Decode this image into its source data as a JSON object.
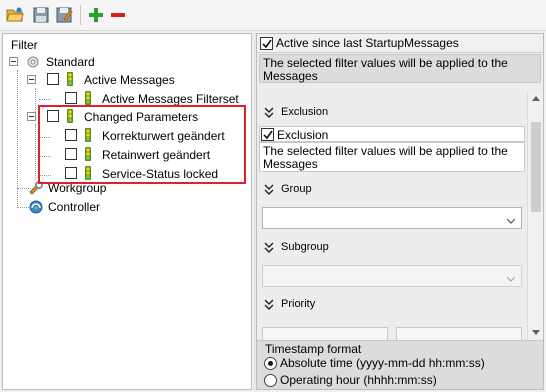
{
  "toolbar": {
    "buttons": [
      "open-folder-icon",
      "save-icon",
      "save-as-icon",
      "add-icon",
      "remove-icon"
    ]
  },
  "left_panel": {
    "title": "Filter",
    "tree": {
      "root": "Standard",
      "active_messages": "Active Messages",
      "active_messages_filterset": "Active Messages Filterset",
      "changed_parameters": "Changed Parameters",
      "korrekturwert": "Korrekturwert geändert",
      "retainwert": "Retainwert geändert",
      "service_status": "Service-Status locked",
      "workgroup": "Workgroup",
      "controller": "Controller"
    }
  },
  "right_panel": {
    "active_since_label": "Active since last StartupMessages",
    "active_since_checked": true,
    "info_text": "The selected filter values  will be applied to the Messages",
    "sections": {
      "exclusion_title": "Exclusion",
      "exclusion_checkbox_label": "Exclusion",
      "exclusion_checked": true,
      "exclusion_info": "The selected filter values  will be applied to the Messages",
      "group_title": "Group",
      "group_value": "",
      "subgroup_title": "Subgroup",
      "subgroup_value": "",
      "priority_title": "Priority"
    },
    "timestamp": {
      "title": "Timestamp format",
      "option_absolute": "Absolute time   (yyyy-mm-dd hh:mm:ss)",
      "option_operating": "Operating hour   (hhhh:mm:ss)",
      "selected": "absolute"
    }
  },
  "colors": {
    "highlight": "#e0202a",
    "add": "#2ca02c",
    "remove": "#d62020"
  }
}
